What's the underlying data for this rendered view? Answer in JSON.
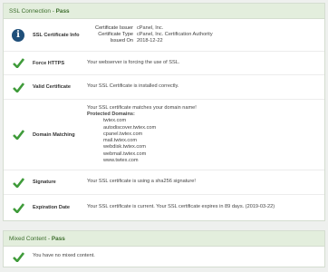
{
  "ssl_panel": {
    "title": "SSL Connection - ",
    "status": "Pass",
    "info_row": {
      "label": "SSL Certificate Info",
      "fields": [
        {
          "key": "Certificate Issuer",
          "value": "cPanel, Inc."
        },
        {
          "key": "Certificate Type",
          "value": "cPanel, Inc. Certification Authority"
        },
        {
          "key": "Issued On",
          "value": "2018-12-22"
        }
      ]
    },
    "force_https": {
      "label": "Force HTTPS",
      "value": "Your webserver is forcing the use of SSL."
    },
    "valid_cert": {
      "label": "Valid Certificate",
      "value": "Your SSL Certificate is installed correctly."
    },
    "domain_matching": {
      "label": "Domain Matching",
      "line1": "Your SSL certificate matches your domain name!",
      "protected_label": "Protected Domains:",
      "domains": [
        "twtex.com",
        "autodiscover.twtex.com",
        "cpanel.twtex.com",
        "mail.twtex.com",
        "webdisk.twtex.com",
        "webmail.twtex.com",
        "www.twtex.com"
      ]
    },
    "signature": {
      "label": "Signature",
      "value": "Your SSL certificate is using a sha256 signature!"
    },
    "expiration": {
      "label": "Expiration Date",
      "value": "Your SSL certificate is current. Your SSL certificate expires in 89 days. (2019-03-22)"
    }
  },
  "mixed_panel": {
    "title": "Mixed Content - ",
    "status": "Pass",
    "row": {
      "value": "You have no mixed content."
    }
  },
  "colors": {
    "check": "#3f9b3a",
    "info": "#1f4f7a",
    "header_bg": "#e3eedd"
  }
}
